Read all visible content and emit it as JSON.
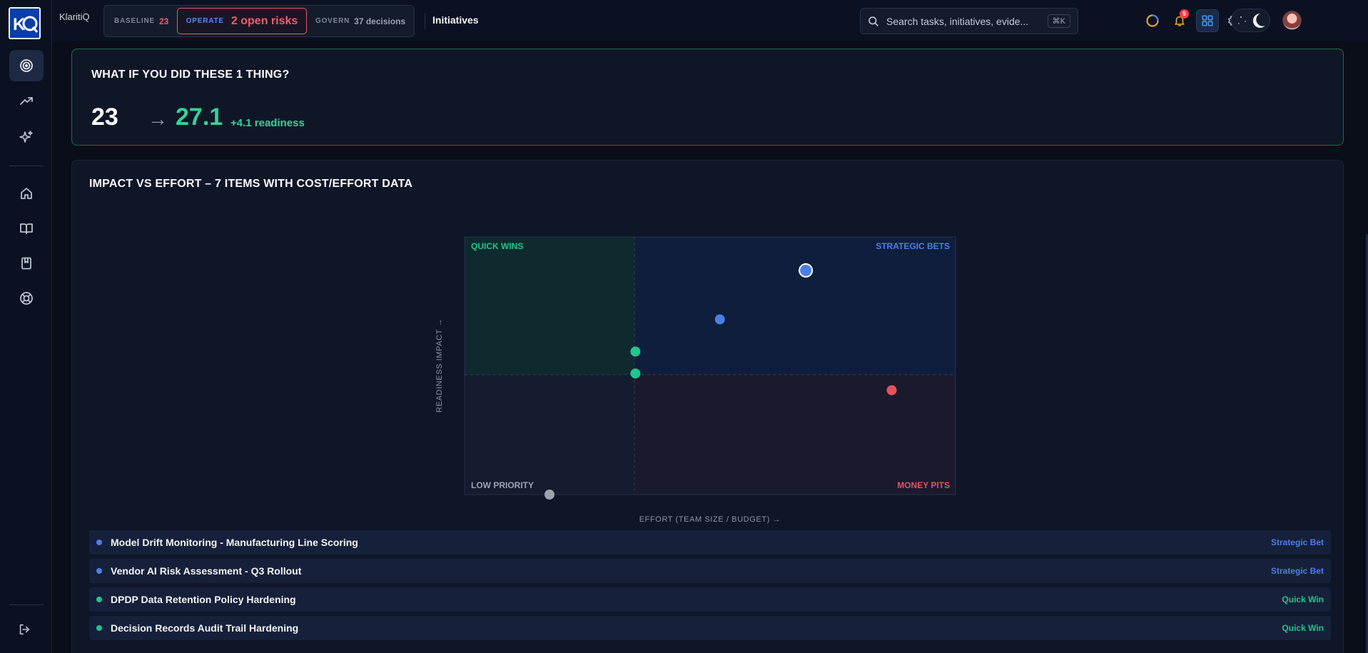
{
  "app": {
    "brand": "KlaritiQ"
  },
  "status": {
    "baseline": {
      "label": "BASELINE",
      "value": "23"
    },
    "operate": {
      "label": "OPERATE",
      "value": "2 open risks"
    },
    "govern": {
      "label": "GOVERN",
      "value": "37 decisions"
    }
  },
  "breadcrumb": "Initiatives",
  "search": {
    "placeholder": "Search tasks, initiatives, evide...",
    "shortcut": "⌘K"
  },
  "notifications": {
    "count": "5"
  },
  "whatif": {
    "title": "WHAT IF YOU DID THESE 1 THING?",
    "from": "23",
    "arrow": "→",
    "to": "27.1",
    "delta": "+4.1 readiness"
  },
  "matrix": {
    "title": "IMPACT VS EFFORT – 7 ITEMS WITH COST/EFFORT DATA",
    "quadrants": {
      "quick_wins": "QUICK WINS",
      "strategic_bets": "STRATEGIC BETS",
      "low_priority": "LOW PRIORITY",
      "money_pits": "MONEY PITS"
    },
    "ylabel": "READINESS IMPACT →",
    "xlabel": "EFFORT (TEAM SIZE / BUDGET) →",
    "colors": {
      "strategic": "#4c7fe6",
      "quick": "#22c58b",
      "money": "#e5525e",
      "low": "#9ca3af"
    }
  },
  "chart_data": {
    "type": "scatter",
    "title": "IMPACT VS EFFORT – 7 ITEMS WITH COST/EFFORT DATA",
    "xlabel": "EFFORT (TEAM SIZE / BUDGET) →",
    "ylabel": "READINESS IMPACT →",
    "xlim": [
      0,
      1
    ],
    "ylim": [
      0,
      1
    ],
    "points": [
      {
        "x": 0.695,
        "y": 0.87,
        "quadrant": "strategic",
        "highlighted": true
      },
      {
        "x": 0.52,
        "y": 0.68,
        "quadrant": "strategic"
      },
      {
        "x": 0.348,
        "y": 0.555,
        "quadrant": "quick"
      },
      {
        "x": 0.348,
        "y": 0.47,
        "quadrant": "quick"
      },
      {
        "x": 0.87,
        "y": 0.405,
        "quadrant": "money"
      },
      {
        "x": 0.173,
        "y": 0.0,
        "quadrant": "low"
      }
    ]
  },
  "items": [
    {
      "name": "Model Drift Monitoring - Manufacturing Line Scoring",
      "tag": "Strategic Bet",
      "color": "#4c7fe6"
    },
    {
      "name": "Vendor AI Risk Assessment - Q3 Rollout",
      "tag": "Strategic Bet",
      "color": "#4c7fe6"
    },
    {
      "name": "DPDP Data Retention Policy Hardening",
      "tag": "Quick Win",
      "color": "#22c58b"
    },
    {
      "name": "Decision Records Audit Trail Hardening",
      "tag": "Quick Win",
      "color": "#22c58b"
    }
  ]
}
